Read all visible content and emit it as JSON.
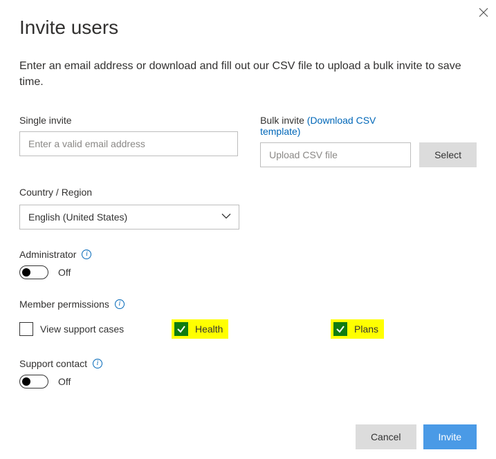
{
  "header": {
    "title": "Invite users",
    "subtitle": "Enter an email address or download and fill out our CSV file to upload a bulk invite to save time."
  },
  "single_invite": {
    "label": "Single invite",
    "placeholder": "Enter a valid email address"
  },
  "bulk_invite": {
    "label": "Bulk invite ",
    "link_text": "(Download CSV template)",
    "placeholder": "Upload CSV file",
    "select_button": "Select"
  },
  "country": {
    "label": "Country / Region",
    "value": "English (United States)"
  },
  "administrator": {
    "label": "Administrator",
    "state_text": "Off"
  },
  "permissions": {
    "label": "Member permissions",
    "items": [
      {
        "label": "View support cases",
        "checked": false,
        "highlight": false
      },
      {
        "label": "Health",
        "checked": true,
        "highlight": true
      },
      {
        "label": "Plans",
        "checked": true,
        "highlight": true
      }
    ]
  },
  "support_contact": {
    "label": "Support contact",
    "state_text": "Off"
  },
  "footer": {
    "cancel": "Cancel",
    "invite": "Invite"
  }
}
